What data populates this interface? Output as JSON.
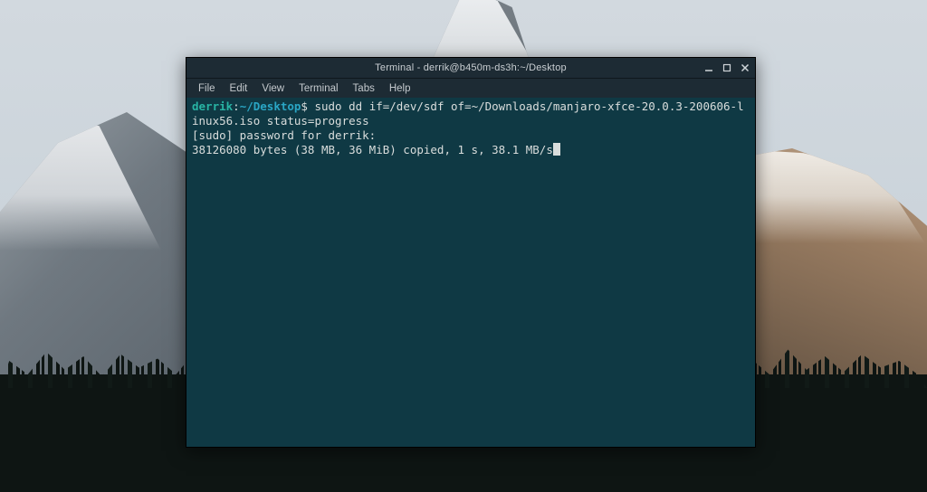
{
  "window": {
    "title": "Terminal - derrik@b450m-ds3h:~/Desktop"
  },
  "menubar": {
    "items": [
      "File",
      "Edit",
      "View",
      "Terminal",
      "Tabs",
      "Help"
    ]
  },
  "terminal": {
    "prompt": {
      "user_host": "derrik",
      "separator": ":",
      "path": "~/Desktop",
      "symbol": "$"
    },
    "command": "sudo dd if=/dev/sdf of=~/Downloads/manjaro-xfce-20.0.3-200606-linux56.iso status=progress",
    "output_line1": "[sudo] password for derrik:",
    "output_line2": "38126080 bytes (38 MB, 36 MiB) copied, 1 s, 38.1 MB/s"
  }
}
